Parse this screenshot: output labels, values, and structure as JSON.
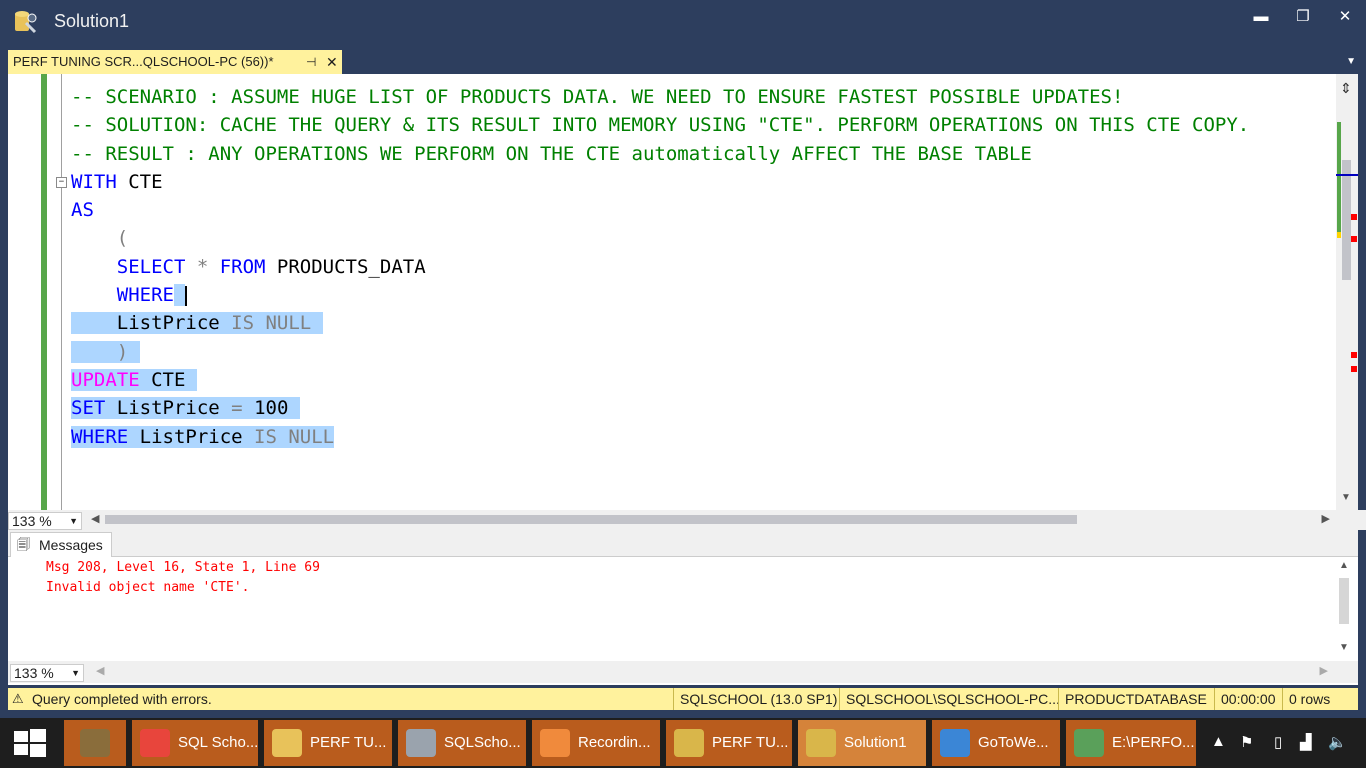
{
  "window": {
    "title": "Solution1",
    "minimize": "▬",
    "restore": "❐",
    "close": "✕"
  },
  "tab": {
    "label": "PERF TUNING  SCR...QLSCHOOL-PC (56))*",
    "pin": "⊣",
    "close": "✕"
  },
  "editor": {
    "lines": [
      {
        "parts": [
          {
            "t": "-- SCENARIO : ASSUME HUGE LIST OF PRODUCTS DATA. WE NEED TO ENSURE FASTEST POSSIBLE UPDATES!",
            "c": "cmt"
          }
        ]
      },
      {
        "parts": [
          {
            "t": "-- SOLUTION: CACHE THE QUERY & ITS RESULT INTO MEMORY USING \"CTE\". PERFORM OPERATIONS ON THIS CTE COPY.",
            "c": "cmt"
          }
        ]
      },
      {
        "parts": [
          {
            "t": "-- RESULT : ANY OPERATIONS WE PERFORM ON THE CTE automatically AFFECT THE BASE TABLE",
            "c": "cmt"
          }
        ]
      },
      {
        "parts": [
          {
            "t": "WITH",
            "c": "kw"
          },
          {
            "t": " CTE",
            "c": "blk"
          }
        ]
      },
      {
        "parts": [
          {
            "t": "AS",
            "c": "kw"
          }
        ]
      },
      {
        "parts": [
          {
            "t": "    (",
            "c": "gray"
          }
        ]
      },
      {
        "parts": [
          {
            "t": "    SELECT",
            "c": "kw"
          },
          {
            "t": " * ",
            "c": "gray"
          },
          {
            "t": "FROM",
            "c": "kw"
          },
          {
            "t": " PRODUCTS_DATA",
            "c": "blk"
          }
        ]
      },
      {
        "parts": [
          {
            "t": "    WHERE",
            "c": "kw"
          },
          {
            "t": " ",
            "c": "blk",
            "sel": true
          }
        ],
        "caret": true
      },
      {
        "parts": [
          {
            "t": "    ListPrice ",
            "c": "blk",
            "sel": true
          },
          {
            "t": "IS NULL",
            "c": "gray",
            "sel": true
          },
          {
            "t": " ",
            "c": "blk",
            "sel": true
          }
        ]
      },
      {
        "parts": [
          {
            "t": "    )",
            "c": "gray",
            "sel": true
          },
          {
            "t": " ",
            "c": "blk",
            "sel": true
          }
        ]
      },
      {
        "parts": [
          {
            "t": "UPDATE",
            "c": "pink",
            "sel": true
          },
          {
            "t": " CTE ",
            "c": "blk",
            "sel": true
          }
        ]
      },
      {
        "parts": [
          {
            "t": "SET",
            "c": "kw",
            "sel": true
          },
          {
            "t": " ListPrice ",
            "c": "blk",
            "sel": true
          },
          {
            "t": "=",
            "c": "gray",
            "sel": true
          },
          {
            "t": " 100 ",
            "c": "blk",
            "sel": true
          }
        ]
      },
      {
        "parts": [
          {
            "t": "WHERE",
            "c": "kw",
            "sel": true
          },
          {
            "t": " ListPrice ",
            "c": "blk",
            "sel": true
          },
          {
            "t": "IS NULL",
            "c": "gray",
            "sel": true
          }
        ]
      }
    ],
    "zoom": "133 %"
  },
  "messages": {
    "tab_label": "Messages",
    "lines": [
      "Msg 208, Level 16, State 1, Line 69",
      "Invalid object name 'CTE'."
    ],
    "zoom": "133 %"
  },
  "status": {
    "text": "Query completed with errors.",
    "server": "SQLSCHOOL (13.0 SP1)",
    "user": "SQLSCHOOL\\SQLSCHOOL-PC...",
    "database": "PRODUCTDATABASE",
    "time": "00:00:00",
    "rows": "0 rows"
  },
  "taskbar": {
    "items": [
      {
        "label": "",
        "icon": "tools-icon",
        "color": "#8a6d3b"
      },
      {
        "label": "SQL Scho...",
        "icon": "chrome-icon",
        "color": "#e8453c"
      },
      {
        "label": "PERF TU...",
        "icon": "folder-icon",
        "color": "#e8c25a"
      },
      {
        "label": "SQLScho...",
        "icon": "drive-icon",
        "color": "#9aa3ad"
      },
      {
        "label": "Recordin...",
        "icon": "recording-icon",
        "color": "#f08a3c"
      },
      {
        "label": "PERF TU...",
        "icon": "ssms-icon",
        "color": "#d9b64a"
      },
      {
        "label": "Solution1",
        "icon": "ssms-icon",
        "color": "#d9b64a",
        "active": true
      },
      {
        "label": "GoToWe...",
        "icon": "gotowebinar-icon",
        "color": "#3b86d6"
      },
      {
        "label": "E:\\PERFO...",
        "icon": "notepad-icon",
        "color": "#5aa05a"
      }
    ]
  }
}
